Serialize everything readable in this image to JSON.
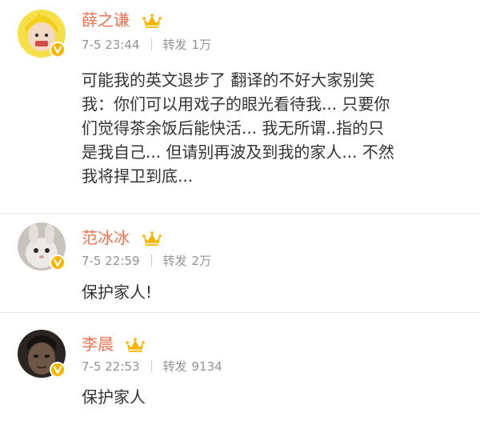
{
  "posts": [
    {
      "username": "薛之谦",
      "time": "7-5 23:44",
      "repost_label": "转发",
      "repost_count": "1万",
      "content": "可能我的英文退步了 翻译的不好大家别笑\n我：你们可以用戏子的眼光看待我... 只要你\n们觉得茶余饭后能快活... 我无所谓..指的只\n是我自己... 但请别再波及到我的家人... 不然\n我将捍卫到底..."
    },
    {
      "username": "范冰冰",
      "time": "7-5 22:59",
      "repost_label": "转发",
      "repost_count": "2万",
      "content": "保护家人!"
    },
    {
      "username": "李晨",
      "time": "7-5 22:53",
      "repost_label": "转发",
      "repost_count": "9134",
      "content": "保护家人"
    }
  ],
  "colors": {
    "username": "#eb7350",
    "meta": "#939393",
    "content": "#333333",
    "verified_badge": "#f7b500",
    "vip_badge": "#f7b500"
  },
  "icons": {
    "avatar_1": "avatar-yellow-hood",
    "avatar_2": "avatar-bunny",
    "avatar_3": "avatar-dark-portrait",
    "verified": "verified-v-icon",
    "vip": "vip-crown-badge-icon"
  }
}
